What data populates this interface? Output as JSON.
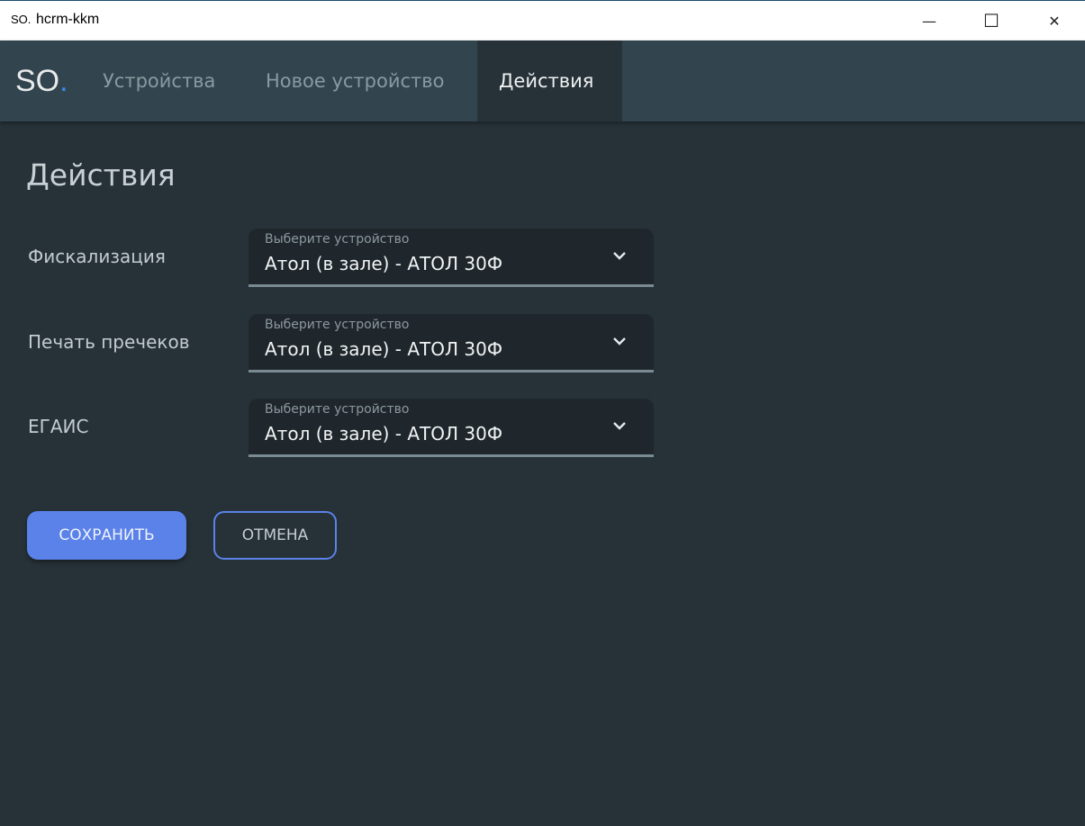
{
  "window": {
    "logo": "SO.",
    "title": "hcrm-kkm",
    "minimize": "—",
    "maximize": "☐",
    "close": "✕"
  },
  "nav": {
    "brand": "SO",
    "brand_dot": ".",
    "tabs": [
      {
        "label": "Устройства"
      },
      {
        "label": "Новое устройство"
      },
      {
        "label": "Действия",
        "active": true
      }
    ]
  },
  "page": {
    "title": "Действия"
  },
  "rows": [
    {
      "label": "Фискализация",
      "placeholder": "Выберите устройство",
      "value": "Атол (в зале) - АТОЛ 30Ф"
    },
    {
      "label": "Печать пречеков",
      "placeholder": "Выберите устройство",
      "value": "Атол (в зале) - АТОЛ 30Ф"
    },
    {
      "label": "ЕГАИС",
      "placeholder": "Выберите устройство",
      "value": "Атол (в зале) - АТОЛ 30Ф"
    }
  ],
  "actions": {
    "save": "СОХРАНИТЬ",
    "cancel": "ОТМЕНА"
  },
  "colors": {
    "accent": "#5b82e8",
    "background": "#263238",
    "appbar": "#32444d"
  }
}
